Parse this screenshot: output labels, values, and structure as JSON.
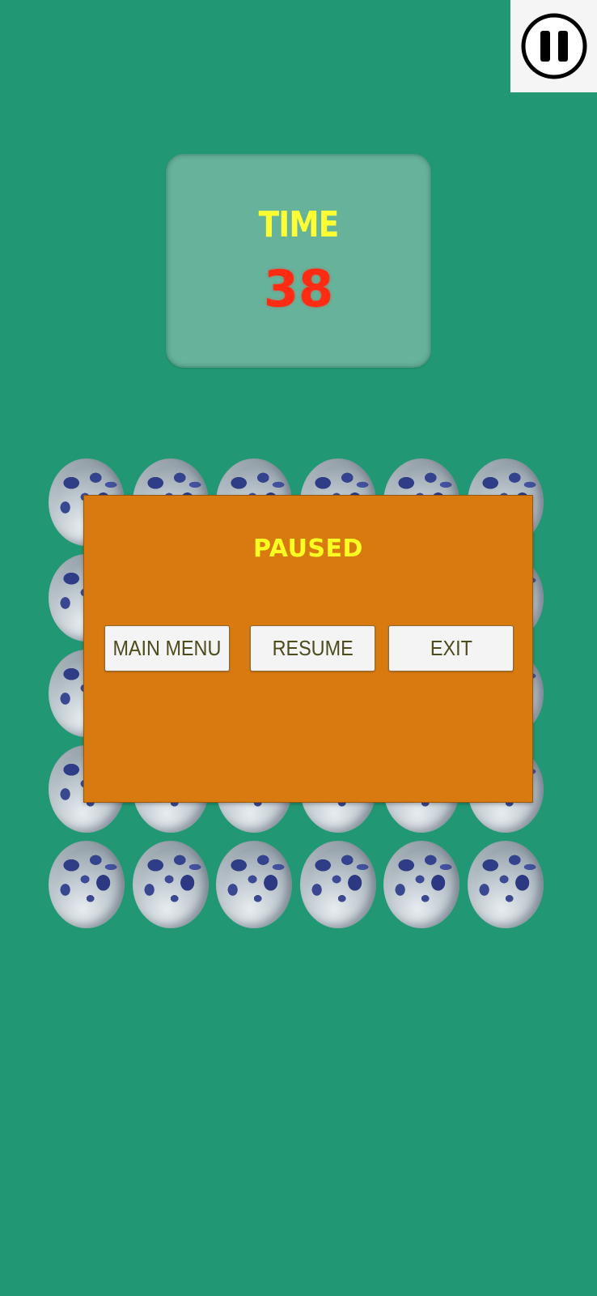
{
  "hud": {
    "time_label": "TIME",
    "time_value": "38"
  },
  "pause_dialog": {
    "title": "PAUSED",
    "buttons": {
      "main_menu": "MAIN MENU",
      "resume": "RESUME",
      "exit": "EXIT"
    }
  },
  "board": {
    "rows": 5,
    "columns": 6,
    "tile_icon": "moon-icon"
  },
  "icons": {
    "pause": "pause-icon"
  },
  "colors": {
    "background": "#219873",
    "time_panel": "#66b29b",
    "time_label": "#ffff33",
    "time_value": "#ff2b12",
    "pause_panel": "#d97a10",
    "paused_title": "#ffff22",
    "button_bg": "#f4f4f4",
    "button_text": "#4d4a1c"
  }
}
